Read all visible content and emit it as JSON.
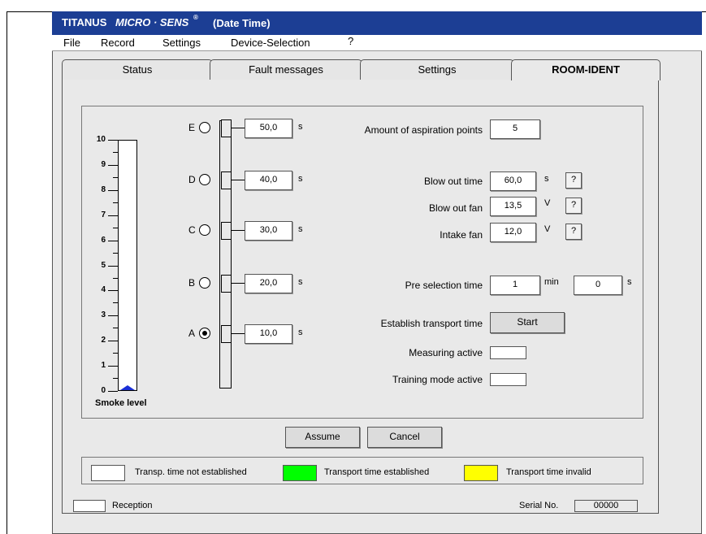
{
  "window": {
    "title_brand": "TITANUS",
    "title_product": "MICRO · SENS",
    "title_reg": "®",
    "title_suffix": "(Date  Time)"
  },
  "menu": [
    "File",
    "Record",
    "Settings",
    "Device-Selection",
    "?"
  ],
  "tabs": [
    {
      "label": "Status",
      "active": false
    },
    {
      "label": "Fault messages",
      "active": false
    },
    {
      "label": "Settings",
      "active": false
    },
    {
      "label": "ROOM-IDENT",
      "active": true
    }
  ],
  "smoke_level": {
    "label": "Smoke level",
    "ticks": [
      "10",
      "9",
      "8",
      "7",
      "6",
      "5",
      "4",
      "3",
      "2",
      "1",
      "0"
    ],
    "value": 0,
    "max": 10,
    "indicator_color": "#1a2fd6"
  },
  "aspiration_points": [
    {
      "letter": "E",
      "value": "50,0",
      "unit": "s",
      "selected": false
    },
    {
      "letter": "D",
      "value": "40,0",
      "unit": "s",
      "selected": false
    },
    {
      "letter": "C",
      "value": "30,0",
      "unit": "s",
      "selected": false
    },
    {
      "letter": "B",
      "value": "20,0",
      "unit": "s",
      "selected": false
    },
    {
      "letter": "A",
      "value": "10,0",
      "unit": "s",
      "selected": true
    }
  ],
  "settings": {
    "amount_label": "Amount of aspiration points",
    "amount_value": "5",
    "blow_out_time_label": "Blow out time",
    "blow_out_time_value": "60,0",
    "blow_out_time_unit": "s",
    "blow_out_fan_label": "Blow out fan",
    "blow_out_fan_value": "13,5",
    "blow_out_fan_unit": "V",
    "intake_fan_label": "Intake fan",
    "intake_fan_value": "12,0",
    "intake_fan_unit": "V",
    "help_label": "?",
    "pre_selection_label": "Pre selection time",
    "pre_selection_min_value": "1",
    "pre_selection_min_unit": "min",
    "pre_selection_sec_value": "0",
    "pre_selection_sec_unit": "s",
    "transport_label": "Establish transport time",
    "start_label": "Start",
    "measuring_label": "Measuring active",
    "training_label": "Training mode active"
  },
  "actions": {
    "assume": "Assume",
    "cancel": "Cancel"
  },
  "legend": [
    {
      "label": "Transp. time not established",
      "color": "#ffffff"
    },
    {
      "label": "Transport time established",
      "color": "#00ff00"
    },
    {
      "label": "Transport time invalid",
      "color": "#ffff00"
    }
  ],
  "footer": {
    "reception_label": "Reception",
    "serial_label": "Serial No.",
    "serial_value": "00000"
  }
}
